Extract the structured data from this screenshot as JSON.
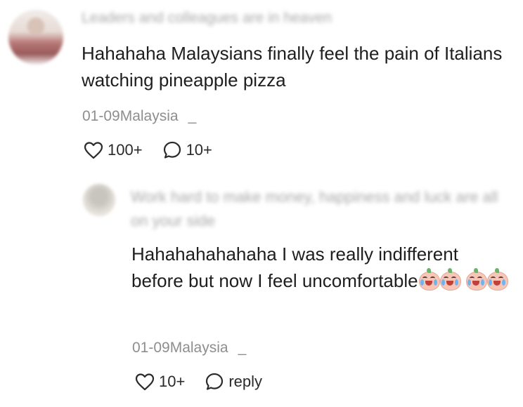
{
  "comment": {
    "username": "Leaders and colleagues are in heaven",
    "text": "Hahahaha Malaysians finally feel the pain of Italians watching pineapple pizza",
    "date": "01-09",
    "location": "Malaysia",
    "like_count": "100+",
    "reply_count": "10+",
    "more_symbol": "_"
  },
  "reply": {
    "username": "Work hard to make money, happiness and luck are all on your side",
    "text": "Hahahahahahaha I was really indifferent before but now I feel uncomfortable",
    "emoji": "crying-laughing-sprout",
    "date": "01-09",
    "location": "Malaysia",
    "like_count": "10+",
    "reply_label": "reply",
    "more_symbol": "_"
  }
}
